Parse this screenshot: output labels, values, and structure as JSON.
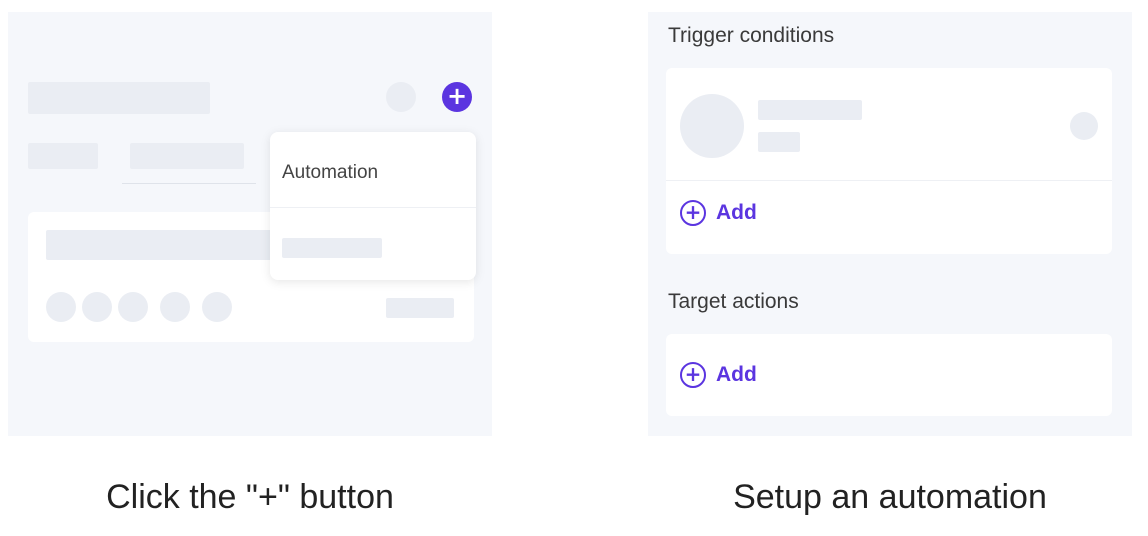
{
  "left_panel": {
    "menu_items": [
      "Automation"
    ],
    "plus_button_icon": "plus-icon",
    "caption": "Click the \"+\" button"
  },
  "right_panel": {
    "trigger_section_title": "Trigger conditions",
    "trigger_add_label": "Add",
    "actions_section_title": "Target actions",
    "actions_add_label": "Add",
    "add_icon": "circle-plus-icon",
    "caption": "Setup an automation"
  },
  "colors": {
    "accent": "#5b35e0",
    "panel_bg": "#f5f7fb",
    "skeleton": "#eaedf3"
  }
}
